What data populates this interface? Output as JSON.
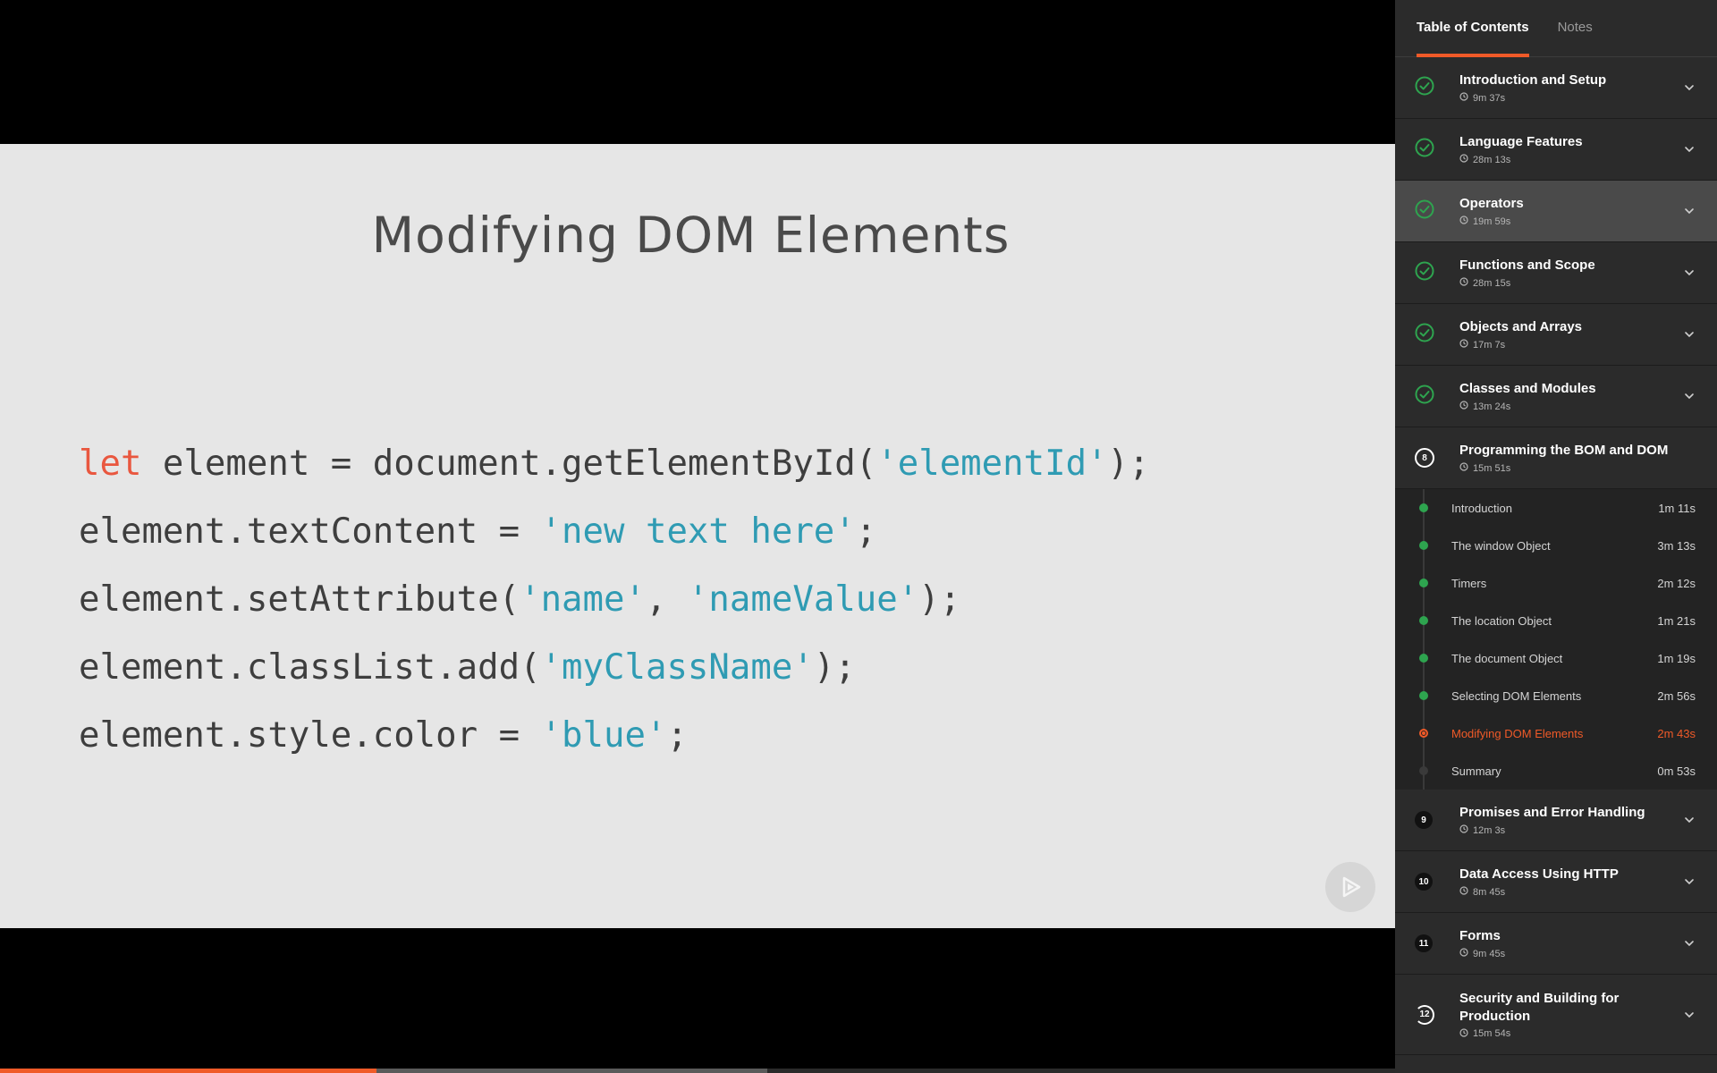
{
  "slide": {
    "title": "Modifying DOM Elements",
    "code": [
      [
        {
          "t": "let",
          "c": "kw"
        },
        {
          "t": " element = document.getElementById(",
          "c": "p"
        },
        {
          "t": "'elementId'",
          "c": "str"
        },
        {
          "t": ");",
          "c": "p"
        }
      ],
      [
        {
          "t": "element.textContent = ",
          "c": "p"
        },
        {
          "t": "'new text here'",
          "c": "str"
        },
        {
          "t": ";",
          "c": "p"
        }
      ],
      [
        {
          "t": "element.setAttribute(",
          "c": "p"
        },
        {
          "t": "'name'",
          "c": "str"
        },
        {
          "t": ", ",
          "c": "p"
        },
        {
          "t": "'nameValue'",
          "c": "str"
        },
        {
          "t": ");",
          "c": "p"
        }
      ],
      [
        {
          "t": "element.classList.add(",
          "c": "p"
        },
        {
          "t": "'myClassName'",
          "c": "str"
        },
        {
          "t": ");",
          "c": "p"
        }
      ],
      [
        {
          "t": "element.style.color = ",
          "c": "p"
        },
        {
          "t": "'blue'",
          "c": "str"
        },
        {
          "t": ";",
          "c": "p"
        }
      ]
    ]
  },
  "player": {
    "progress_fraction": 0.27,
    "buffered_fraction": 0.55,
    "accent": "#f05a28"
  },
  "sidebar": {
    "tabs": [
      {
        "label": "Table of Contents",
        "active": true
      },
      {
        "label": "Notes",
        "active": false
      }
    ],
    "modules": [
      {
        "title": "Introduction and Setup",
        "duration": "9m 37s",
        "status": "done"
      },
      {
        "title": "Language Features",
        "duration": "28m 13s",
        "status": "done"
      },
      {
        "title": "Operators",
        "duration": "19m 59s",
        "status": "done",
        "highlight": true
      },
      {
        "title": "Functions and Scope",
        "duration": "28m 15s",
        "status": "done"
      },
      {
        "title": "Objects and Arrays",
        "duration": "17m 7s",
        "status": "done"
      },
      {
        "title": "Classes and Modules",
        "duration": "13m 24s",
        "status": "done"
      },
      {
        "title": "Programming the BOM and DOM",
        "duration": "15m 51s",
        "status": "current",
        "number": "8",
        "expanded": true,
        "clips": [
          {
            "title": "Introduction",
            "duration": "1m 11s",
            "status": "done"
          },
          {
            "title": "The window Object",
            "duration": "3m 13s",
            "status": "done"
          },
          {
            "title": "Timers",
            "duration": "2m 12s",
            "status": "done"
          },
          {
            "title": "The location Object",
            "duration": "1m 21s",
            "status": "done"
          },
          {
            "title": "The document Object",
            "duration": "1m 19s",
            "status": "done"
          },
          {
            "title": "Selecting DOM Elements",
            "duration": "2m 56s",
            "status": "done"
          },
          {
            "title": "Modifying DOM Elements",
            "duration": "2m 43s",
            "status": "current"
          },
          {
            "title": "Summary",
            "duration": "0m 53s",
            "status": "todo"
          }
        ]
      },
      {
        "title": "Promises and Error Handling",
        "duration": "12m 3s",
        "status": "todo",
        "number": "9"
      },
      {
        "title": "Data Access Using HTTP",
        "duration": "8m 45s",
        "status": "todo",
        "number": "10"
      },
      {
        "title": "Forms",
        "duration": "9m 45s",
        "status": "todo",
        "number": "11"
      },
      {
        "title": "Security and Building for Production",
        "duration": "15m 54s",
        "status": "partial",
        "number": "12"
      }
    ],
    "icons": {
      "complete": "check-circle-icon",
      "duration": "clock-icon",
      "expand": "chevron-down-icon"
    }
  }
}
